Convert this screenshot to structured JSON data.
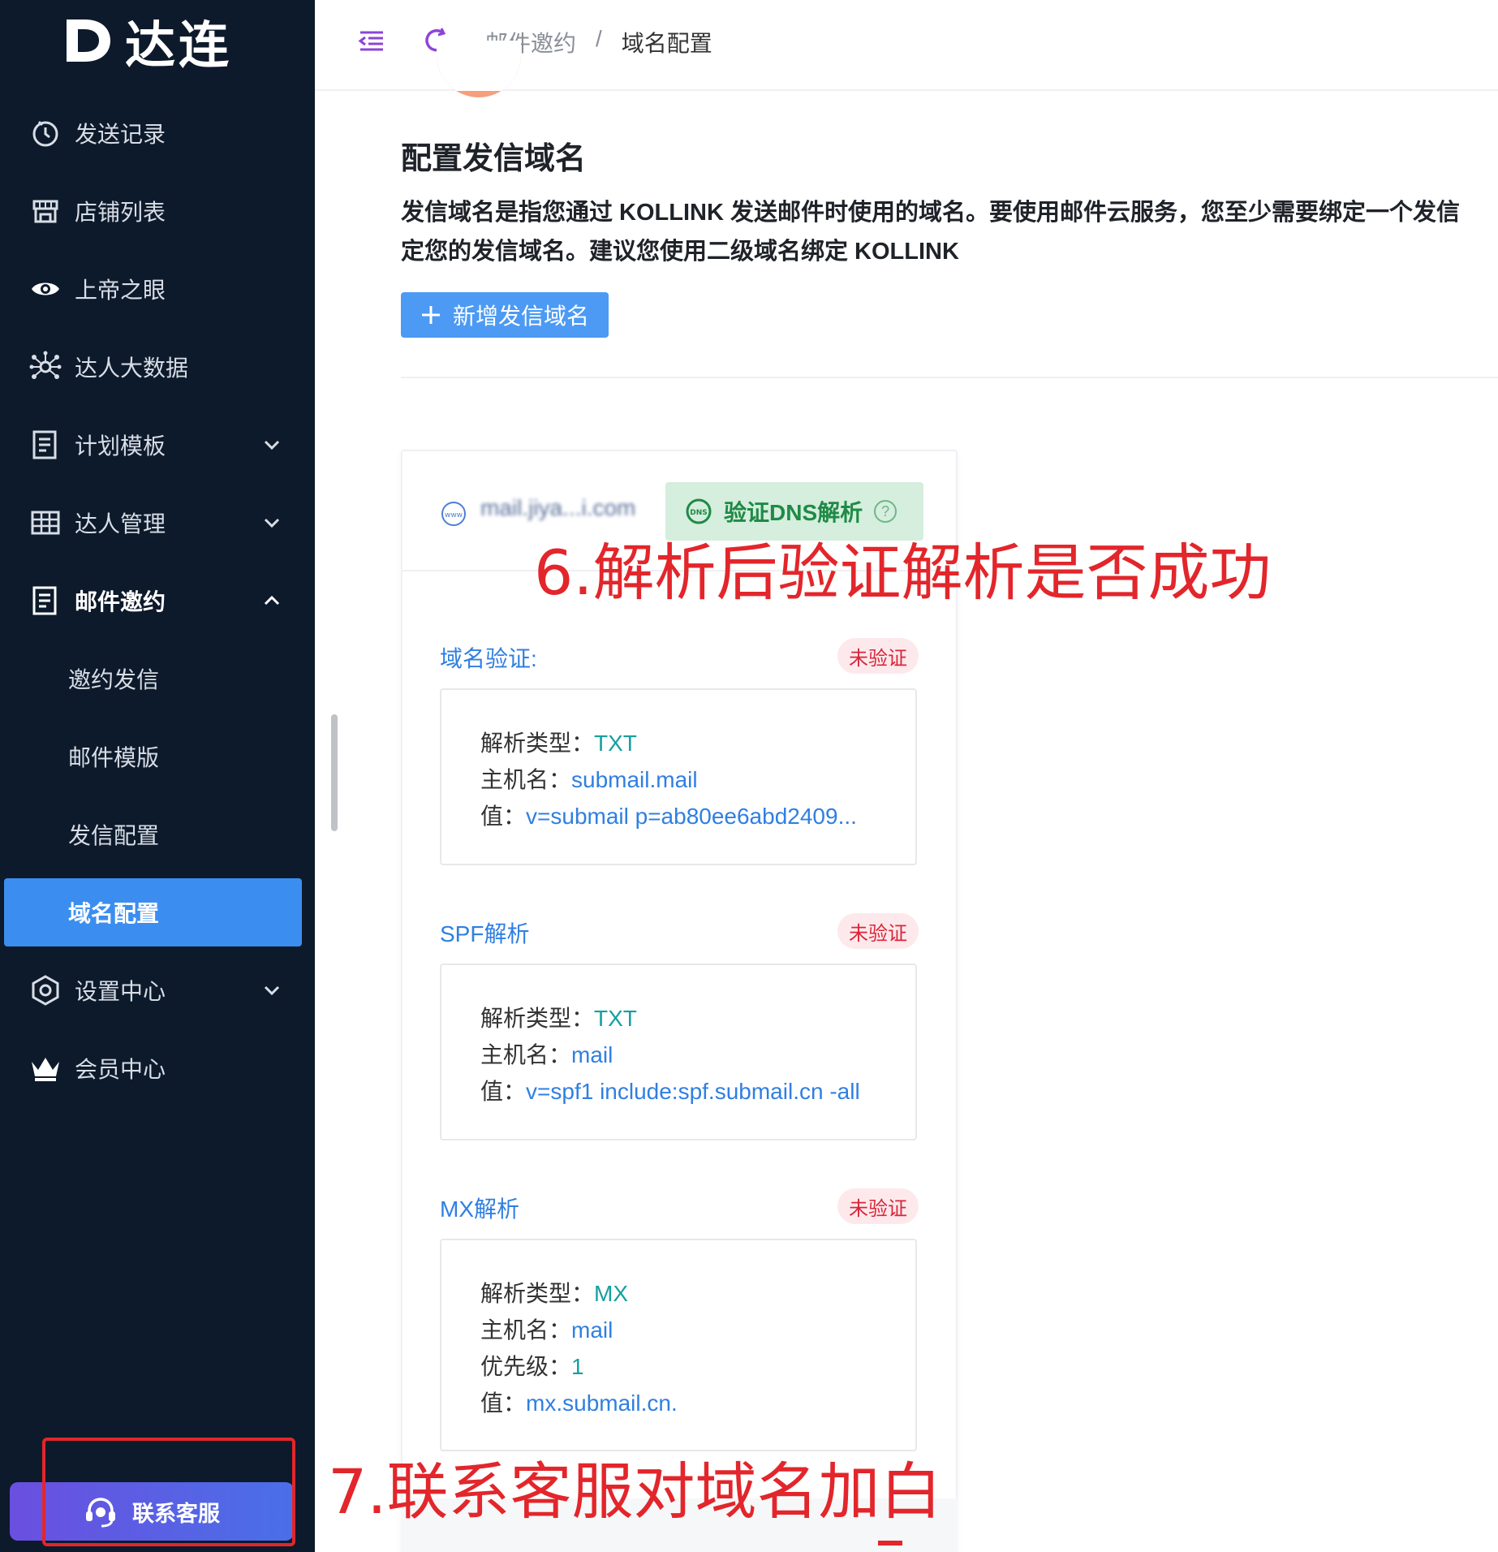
{
  "app": {
    "logo_text": "达连"
  },
  "sidebar": {
    "items": [
      {
        "label": "发送记录",
        "icon": "clock-icon"
      },
      {
        "label": "店铺列表",
        "icon": "store-icon"
      },
      {
        "label": "上帝之眼",
        "icon": "eye-icon"
      },
      {
        "label": "达人大数据",
        "icon": "network-icon"
      },
      {
        "label": "计划模板",
        "icon": "document-icon",
        "expandable": true
      },
      {
        "label": "达人管理",
        "icon": "grid-icon",
        "expandable": true
      },
      {
        "label": "邮件邀约",
        "icon": "document-icon",
        "expandable": true,
        "expanded": true
      },
      {
        "label": "邀约发信"
      },
      {
        "label": "邮件模版"
      },
      {
        "label": "发信配置"
      },
      {
        "label": "域名配置",
        "active": true
      },
      {
        "label": "设置中心",
        "icon": "hexagon-icon",
        "expandable": true
      },
      {
        "label": "会员中心",
        "icon": "crown-icon"
      }
    ],
    "contact_label": "联系客服"
  },
  "header": {
    "breadcrumb": [
      "邮件邀约",
      "/",
      "域名配置"
    ]
  },
  "main": {
    "title": "配置发信域名",
    "description_line1": "发信域名是指您通过 KOLLINK 发送邮件时使用的域名。要使用邮件云服务，您至少需要绑定一个发信",
    "description_line2": "定您的发信域名。建议您使用二级域名绑定 KOLLINK",
    "add_button": "新增发信域名",
    "card": {
      "domain": "mail.jiya...i.com",
      "verify_button": "验证DNS解析",
      "records": [
        {
          "title": "域名验证:",
          "status": "未验证",
          "lines": [
            {
              "key": "解析类型：",
              "value": "TXT",
              "kind": "type"
            },
            {
              "key": "主机名：",
              "value": "submail.mail"
            },
            {
              "key": "值：",
              "value": "v=submail p=ab80ee6abd2409..."
            }
          ]
        },
        {
          "title": "SPF解析",
          "status": "未验证",
          "lines": [
            {
              "key": "解析类型：",
              "value": "TXT",
              "kind": "type"
            },
            {
              "key": "主机名：",
              "value": "mail"
            },
            {
              "key": "值：",
              "value": "v=spf1 include:spf.submail.cn -all"
            }
          ]
        },
        {
          "title": "MX解析",
          "status": "未验证",
          "lines": [
            {
              "key": "解析类型：",
              "value": "MX",
              "kind": "type"
            },
            {
              "key": "主机名：",
              "value": "mail"
            },
            {
              "key": "优先级：",
              "value": "1",
              "kind": "type"
            },
            {
              "key": "值：",
              "value": "mx.submail.cn."
            }
          ]
        }
      ]
    }
  },
  "annotations": {
    "step6": "6.解析后验证解析是否成功",
    "step7": "7.联系客服对域名加白"
  },
  "colors": {
    "sidebar_bg": "#0d1a2b",
    "active": "#3b8ef0",
    "link": "#2f7fe2",
    "annotation": "#e2262b",
    "badge": "#d9263a",
    "verify_green": "#1f8a46"
  }
}
